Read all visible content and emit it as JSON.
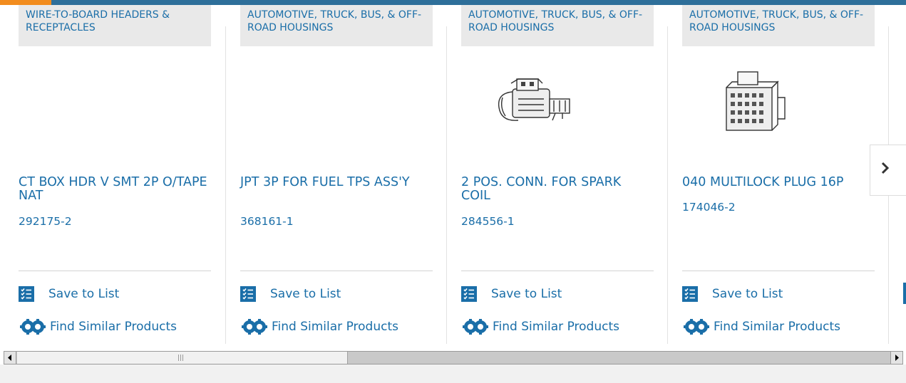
{
  "cards": [
    {
      "category": "WIRE-TO-BOARD HEADERS & RECEPTACLES",
      "name": "CT BOX HDR V SMT 2P O/TAPE NAT",
      "part_number": "292175-2",
      "save_label": "Save to List",
      "find_label": "Find Similar Products"
    },
    {
      "category": "AUTOMOTIVE, TRUCK, BUS, & OFF-ROAD HOUSINGS",
      "name": "JPT 3P FOR FUEL TPS ASS'Y",
      "part_number": "368161-1",
      "save_label": "Save to List",
      "find_label": "Find Similar Products"
    },
    {
      "category": "AUTOMOTIVE, TRUCK, BUS, & OFF-ROAD HOUSINGS",
      "name": "2 POS. CONN. FOR SPARK COIL",
      "part_number": "284556-1",
      "save_label": "Save to List",
      "find_label": "Find Similar Products"
    },
    {
      "category": "AUTOMOTIVE, TRUCK, BUS, & OFF-ROAD HOUSINGS",
      "name": "040 MULTILOCK PLUG 16P",
      "part_number": "174046-2",
      "save_label": "Save to List",
      "find_label": "Find Similar Products"
    }
  ],
  "carousel": {
    "next_icon": "chevron-right-icon"
  },
  "colors": {
    "accent": "#f28c1e",
    "brand": "#2e6f9a",
    "link": "#1a6ea8"
  },
  "scrollbar": {
    "position": 0.39
  }
}
